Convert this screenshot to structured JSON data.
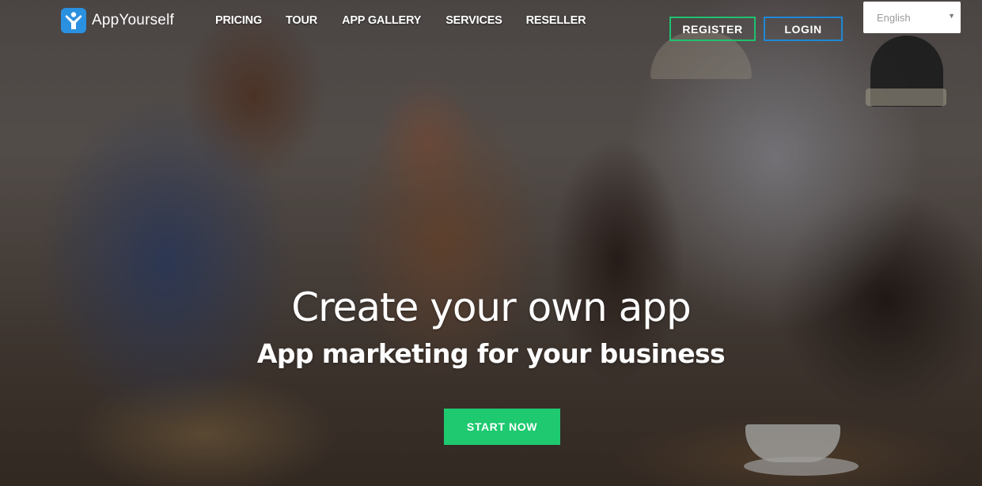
{
  "brand": {
    "name": "AppYourself",
    "logo_icon": "person-raising-arms-icon",
    "color": "#2a90e0"
  },
  "nav": {
    "items": [
      {
        "label": "PRICING"
      },
      {
        "label": "TOUR"
      },
      {
        "label": "APP GALLERY"
      },
      {
        "label": "SERVICES"
      },
      {
        "label": "RESELLER"
      }
    ]
  },
  "auth": {
    "register_label": "REGISTER",
    "register_color": "#1ec26f",
    "login_label": "LOGIN",
    "login_color": "#1e88d6"
  },
  "language": {
    "selected": "English",
    "caret_icon": "caret-down-icon"
  },
  "hero": {
    "title": "Create your own app",
    "subtitle": "App marketing for your business",
    "cta_label": "START NOW",
    "cta_color": "#1ec96f",
    "background": "cafe-photo-two-baristas-with-tablet"
  }
}
